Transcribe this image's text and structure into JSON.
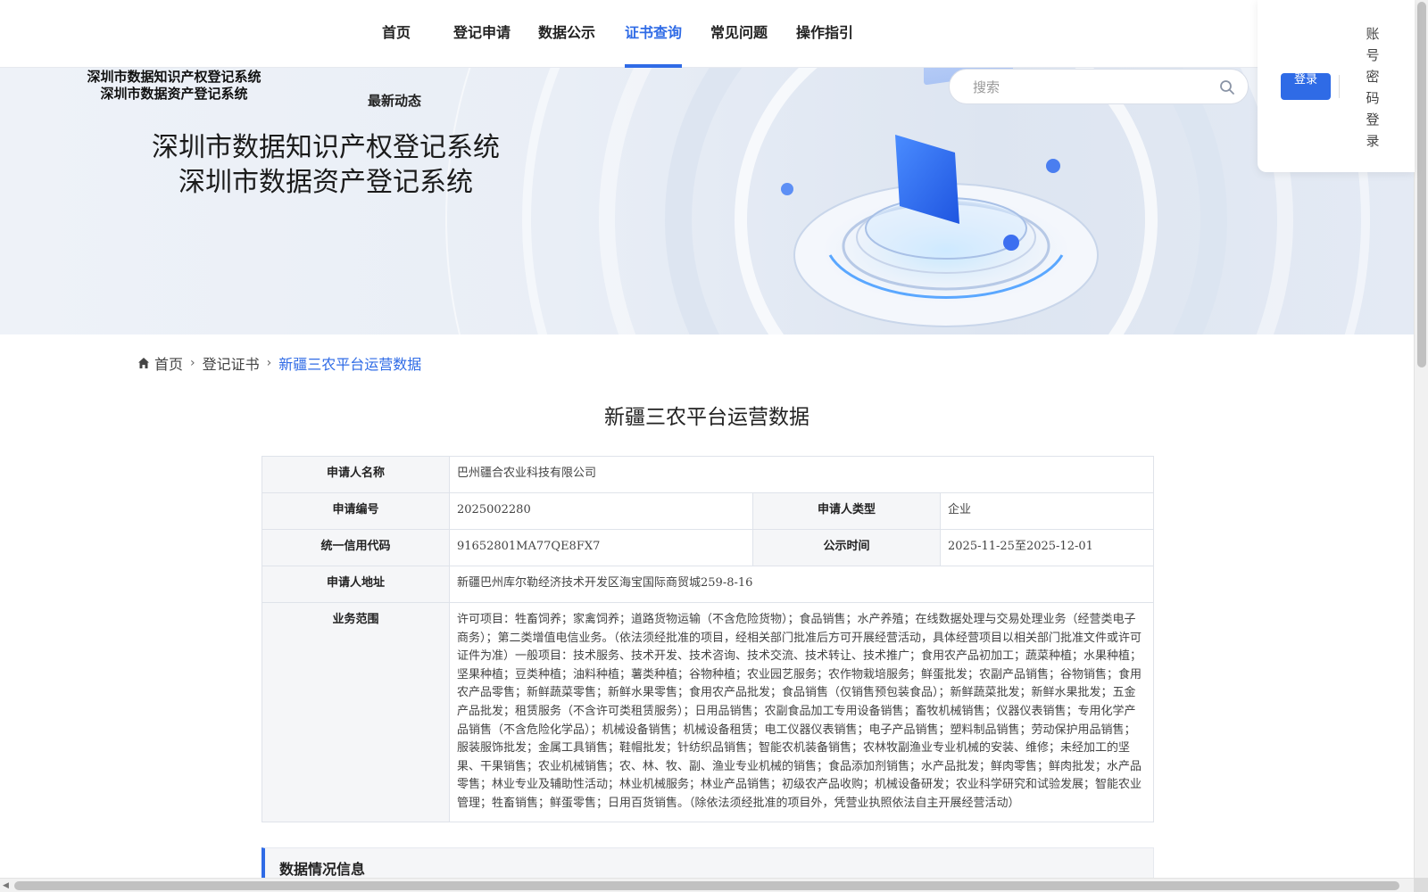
{
  "nav": {
    "items": [
      {
        "label": "首页"
      },
      {
        "label": "登记申请"
      },
      {
        "label": "数据公示"
      },
      {
        "label": "证书查询",
        "active": true
      },
      {
        "label": "常见问题"
      },
      {
        "label": "操作指引"
      }
    ],
    "active_color": "#2f6be6"
  },
  "banner": {
    "small_title_1": "深圳市数据知识产权登记系统",
    "small_title_2": "深圳市数据资产登记系统",
    "latest_news": "最新动态",
    "big_title_1": "深圳市数据知识产权登记系统",
    "big_title_2": "深圳市数据资产登记系统"
  },
  "search": {
    "placeholder": "搜索",
    "icon": "search-icon"
  },
  "login": {
    "login_label": "登录",
    "password_login_label": "账号密码登录"
  },
  "breadcrumb": {
    "home": "首页",
    "level2": "登记证书",
    "current": "新疆三农平台运营数据"
  },
  "page_title": "新疆三农平台运营数据",
  "info": {
    "applicant_name_label": "申请人名称",
    "applicant_name": "巴州疆合农业科技有限公司",
    "application_no_label": "申请编号",
    "application_no": "2025002280",
    "applicant_type_label": "申请人类型",
    "applicant_type": "企业",
    "credit_code_label": "统一信用代码",
    "credit_code": "91652801MA77QE8FX7",
    "publicity_time_label": "公示时间",
    "publicity_time": "2025-11-25至2025-12-01",
    "address_label": "申请人地址",
    "address": "新疆巴州库尔勒经济技术开发区海宝国际商贸城259-8-16",
    "business_scope_label": "业务范围",
    "business_scope": "许可项目：牲畜饲养；家禽饲养；道路货物运输（不含危险货物）；食品销售；水产养殖；在线数据处理与交易处理业务（经营类电子商务）；第二类增值电信业务。（依法须经批准的项目，经相关部门批准后方可开展经营活动，具体经营项目以相关部门批准文件或许可证件为准）一般项目：技术服务、技术开发、技术咨询、技术交流、技术转让、技术推广；食用农产品初加工；蔬菜种植；水果种植；坚果种植；豆类种植；油料种植；薯类种植；谷物种植；农业园艺服务；农作物栽培服务；鲜蛋批发；农副产品销售；谷物销售；食用农产品零售；新鲜蔬菜零售；新鲜水果零售；食用农产品批发；食品销售（仅销售预包装食品）；新鲜蔬菜批发；新鲜水果批发；五金产品批发；租赁服务（不含许可类租赁服务）；日用品销售；农副食品加工专用设备销售；畜牧机械销售；仪器仪表销售；专用化学产品销售（不含危险化学品）；机械设备销售；机械设备租赁；电工仪器仪表销售；电子产品销售；塑料制品销售；劳动保护用品销售；服装服饰批发；金属工具销售；鞋帽批发；针纺织品销售；智能农机装备销售；农林牧副渔业专业机械的安装、维修；未经加工的坚果、干果销售；农业机械销售；农、林、牧、副、渔业专业机械的销售；食品添加剂销售；水产品批发；鲜肉零售；鲜肉批发；水产品零售；林业专业及辅助性活动；林业机械服务；林业产品销售；初级农产品收购；机械设备研发；农业科学研究和试验发展；智能农业管理；牲畜销售；鲜蛋零售；日用百货销售。（除依法须经批准的项目外，凭营业执照依法自主开展经营活动）"
  },
  "section": {
    "data_info_title": "数据情况信息"
  }
}
